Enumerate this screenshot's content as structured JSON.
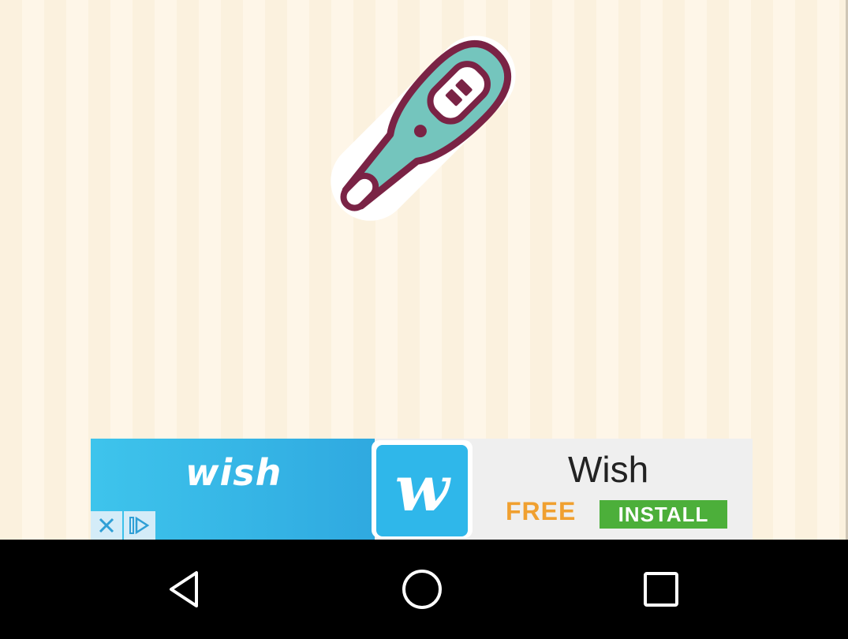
{
  "game": {
    "picture_icon": "thermometer-icon"
  },
  "ad": {
    "brand_text": "wish",
    "logo_letter": "w",
    "title": "Wish",
    "free_label": "FREE",
    "install_label": "INSTALL",
    "close_icon": "close-icon",
    "adchoices_icon": "adchoices-icon",
    "colors": {
      "blue": "#2fb7ea",
      "green": "#4caf3a",
      "orange": "#f0a030"
    }
  },
  "navbar": {
    "back_icon": "back-triangle-icon",
    "home_icon": "home-circle-icon",
    "recents_icon": "recents-square-icon"
  }
}
